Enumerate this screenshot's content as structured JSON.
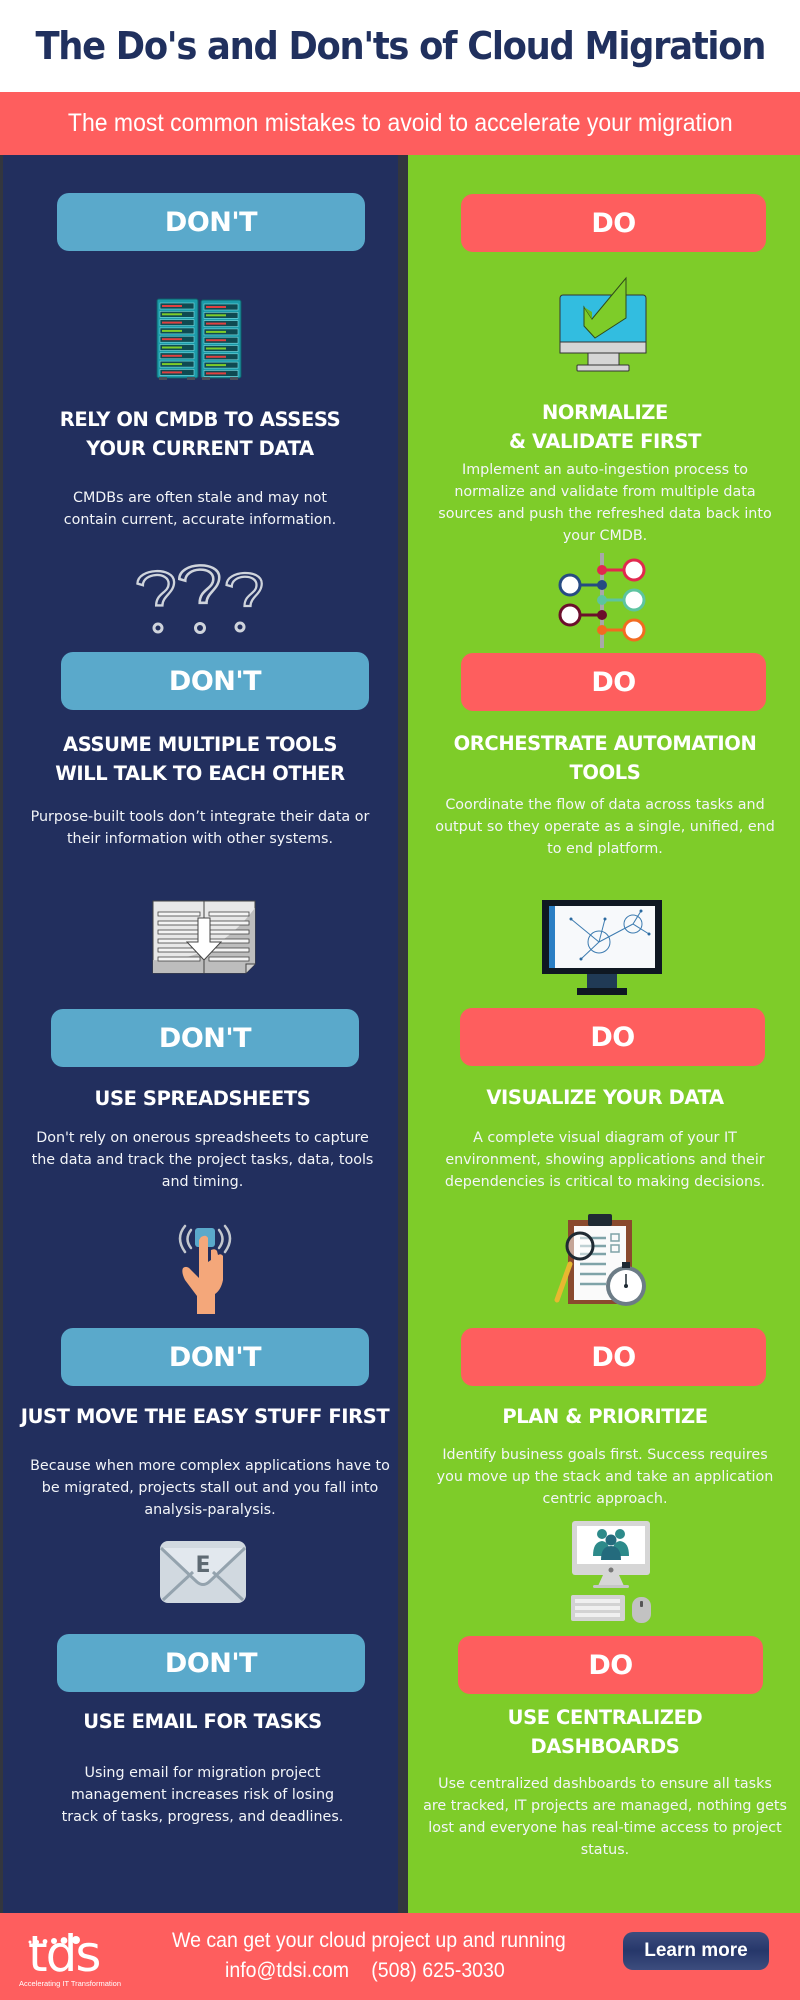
{
  "header": {
    "title": "The Do's and Don'ts of Cloud Migration",
    "subtitle": "The most common mistakes to avoid to accelerate your migration"
  },
  "colors": {
    "title_text": "#20305e",
    "accent_red": "#fe5e5e",
    "dont_panel": "#222f5e",
    "do_panel": "#7ecc29",
    "dont_pill": "#5aa9cb",
    "do_pill": "#fe5e5e"
  },
  "donts": [
    {
      "label": "DON'T",
      "icon": "server-rack-icon",
      "heading": [
        "RELY ON CMDB TO ASSESS",
        "YOUR CURRENT DATA"
      ],
      "description": [
        "CMDBs are often stale and may not",
        "contain current, accurate information."
      ]
    },
    {
      "label": "DON'T",
      "icon": "question-marks-icon",
      "heading": [
        "ASSUME MULTIPLE TOOLS",
        "WILL TALK TO EACH OTHER"
      ],
      "description": [
        "Purpose-built tools don’t integrate their data or",
        "their information with other systems."
      ]
    },
    {
      "label": "DON'T",
      "icon": "spreadsheet-download-icon",
      "heading": [
        "USE SPREADSHEETS"
      ],
      "description": [
        "Don't rely on onerous spreadsheets to capture",
        "the data and track the project tasks, data, tools",
        "and timing."
      ]
    },
    {
      "label": "DON'T",
      "icon": "hand-pressing-button-icon",
      "heading": [
        "JUST MOVE THE EASY STUFF FIRST"
      ],
      "description": [
        "Because when more complex applications have to",
        "be migrated, projects stall out and you fall into",
        "analysis-paralysis."
      ]
    },
    {
      "label": "DON'T",
      "icon": "email-envelope-icon",
      "heading": [
        "USE EMAIL FOR TASKS"
      ],
      "description": [
        "Using email for migration project",
        "management  increases risk of losing",
        "track of tasks, progress, and deadlines."
      ]
    }
  ],
  "dos": [
    {
      "label": "DO",
      "icon": "monitor-checkmark-icon",
      "heading": [
        "NORMALIZE",
        "& VALIDATE FIRST"
      ],
      "description": [
        "Implement an auto-ingestion process to",
        "normalize and validate from multiple data",
        "sources and push the refreshed data back into",
        "your CMDB."
      ]
    },
    {
      "label": "DO",
      "icon": "workflow-nodes-icon",
      "heading": [
        "ORCHESTRATE AUTOMATION",
        "TOOLS"
      ],
      "description": [
        "Coordinate the flow of data across tasks and",
        "output so they operate as a single, unified, end",
        "to end platform."
      ]
    },
    {
      "label": "DO",
      "icon": "monitor-diagram-icon",
      "heading": [
        "VISUALIZE YOUR DATA"
      ],
      "description": [
        "A complete visual diagram of your IT",
        "environment, showing applications and their",
        "dependencies is critical to making decisions."
      ]
    },
    {
      "label": "DO",
      "icon": "clipboard-stopwatch-icon",
      "heading": [
        "PLAN & PRIORITIZE"
      ],
      "description": [
        "Identify business goals first. Success requires",
        "you move up the stack and take an application",
        "centric approach."
      ]
    },
    {
      "label": "DO",
      "icon": "desktop-team-icon",
      "heading": [
        "USE CENTRALIZED",
        "DASHBOARDS"
      ],
      "description": [
        " Use centralized dashboards to ensure all tasks",
        "are tracked, IT projects are managed, nothing gets",
        "lost and everyone has real-time access to project",
        "status."
      ]
    }
  ],
  "footer": {
    "logo_text": "tds",
    "logo_tagline": "Accelerating IT Transformation",
    "line1": "We can get your cloud project up and running",
    "email": "info@tdsi.com",
    "phone": "(508) 625-3030",
    "cta_label": "Learn more"
  }
}
